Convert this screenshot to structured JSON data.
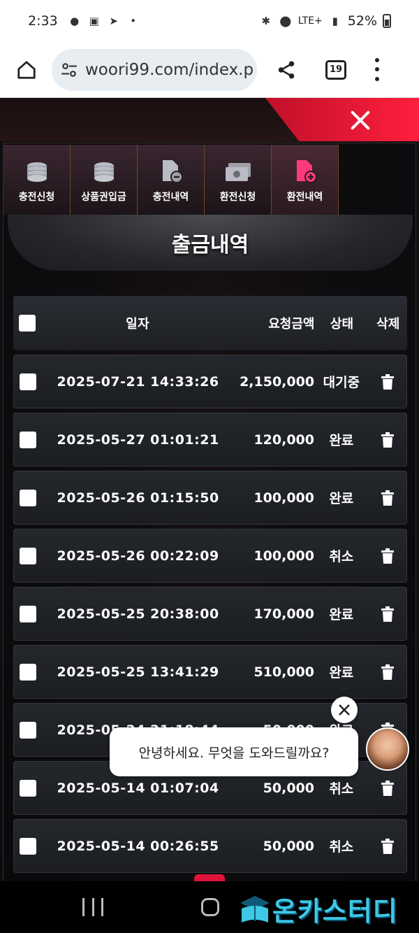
{
  "status_bar": {
    "time": "2:33",
    "network": "LTE+",
    "battery": "52%"
  },
  "browser": {
    "url": "woori99.com/index.p",
    "tab_count": "19"
  },
  "tabs": [
    {
      "label": "충전신청",
      "icon": "coins-icon"
    },
    {
      "label": "상품권입금",
      "icon": "coins-icon"
    },
    {
      "label": "충전내역",
      "icon": "document-minus-icon"
    },
    {
      "label": "환전신청",
      "icon": "money-icon"
    },
    {
      "label": "환전내역",
      "icon": "document-plus-icon",
      "active": true
    }
  ],
  "section_title": "출금내역",
  "table": {
    "headers": {
      "date": "일자",
      "amount": "요청금액",
      "status": "상태",
      "delete": "삭제"
    },
    "rows": [
      {
        "date": "2025-07-21 14:33:26",
        "amount": "2,150,000",
        "status": "대기중"
      },
      {
        "date": "2025-05-27 01:01:21",
        "amount": "120,000",
        "status": "완료"
      },
      {
        "date": "2025-05-26 01:15:50",
        "amount": "100,000",
        "status": "완료"
      },
      {
        "date": "2025-05-26 00:22:09",
        "amount": "100,000",
        "status": "취소"
      },
      {
        "date": "2025-05-25 20:38:00",
        "amount": "170,000",
        "status": "완료"
      },
      {
        "date": "2025-05-25 13:41:29",
        "amount": "510,000",
        "status": "완료"
      },
      {
        "date": "2025-05-24 21:18:44",
        "amount": "50,000",
        "status": "완료"
      },
      {
        "date": "2025-05-14 01:07:04",
        "amount": "50,000",
        "status": "취소"
      },
      {
        "date": "2025-05-14 00:26:55",
        "amount": "50,000",
        "status": "취소"
      }
    ]
  },
  "chat": {
    "message": "안녕하세요. 무엇을 도와드릴까요?"
  },
  "watermark": "온카스터디",
  "colors": {
    "accent": "#e0143a",
    "watermark": "#3ec8e6"
  }
}
